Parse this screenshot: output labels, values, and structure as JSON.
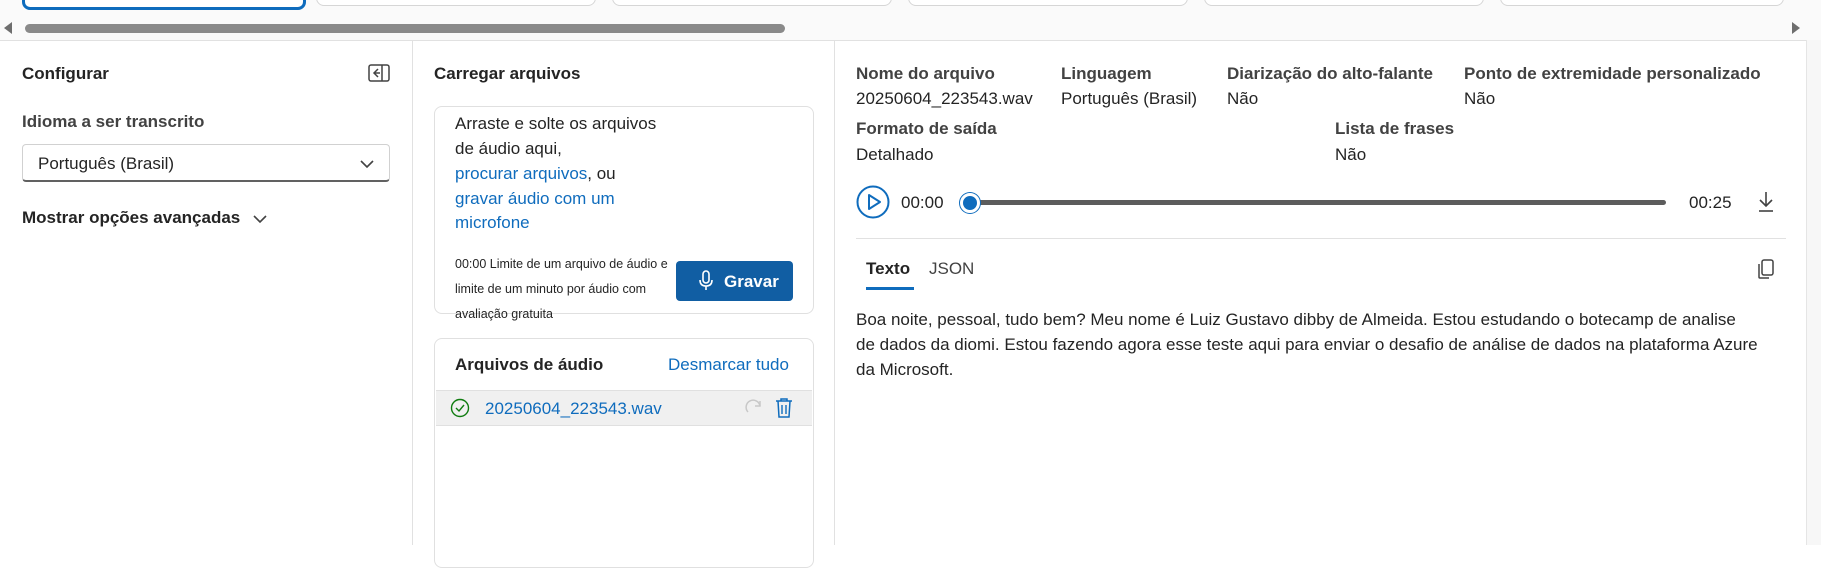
{
  "left_panel": {
    "title": "Configurar",
    "language_label": "Idioma a ser transcrito",
    "language_value": "Português (Brasil)",
    "advanced_options": "Mostrar opções avançadas"
  },
  "upload_panel": {
    "title": "Carregar arquivos",
    "drop_line1": "Arraste e solte os arquivos",
    "drop_line2": "de áudio aqui,",
    "browse_link": "procurar arquivos",
    "or_text": ", ou",
    "record_link_line1": "gravar áudio com um",
    "record_link_line2": "microfone",
    "limit_line1": "00:00 Limite de um arquivo de áudio e",
    "limit_line2": "limite de um minuto por áudio com",
    "limit_line3": "avaliação gratuita",
    "record_button": "Gravar",
    "audio_files_title": "Arquivos de áudio",
    "deselect_all": "Desmarcar tudo",
    "files": [
      {
        "name": "20250604_223543.wav"
      }
    ]
  },
  "details": {
    "file_name_label": "Nome do arquivo",
    "file_name_value": "20250604_223543.wav",
    "language_label": "Linguagem",
    "language_value": "Português (Brasil)",
    "diarization_label": "Diarização do alto-falante",
    "diarization_value": "Não",
    "endpoint_label": "Ponto de extremidade personalizado",
    "endpoint_value": "Não",
    "output_format_label": "Formato de saída",
    "output_format_value": "Detalhado",
    "phrase_list_label": "Lista de frases",
    "phrase_list_value": "Não"
  },
  "player": {
    "current_time": "00:00",
    "duration": "00:25",
    "progress": 0
  },
  "result_tabs": {
    "text_tab": "Texto",
    "json_tab": "JSON",
    "active": "Texto"
  },
  "transcript": {
    "line1": "Boa noite, pessoal, tudo bem? Meu nome é Luiz Gustavo dibby de Almeida. Estou estudando o botecamp de analise",
    "line2": "de dados da diomi. Estou fazendo agora esse teste aqui para enviar o desafio de análise de dados na plataforma Azure",
    "line3": "da Microsoft."
  },
  "colors": {
    "accent": "#0f6cbd",
    "button": "#115ea3",
    "success": "#107c10"
  }
}
